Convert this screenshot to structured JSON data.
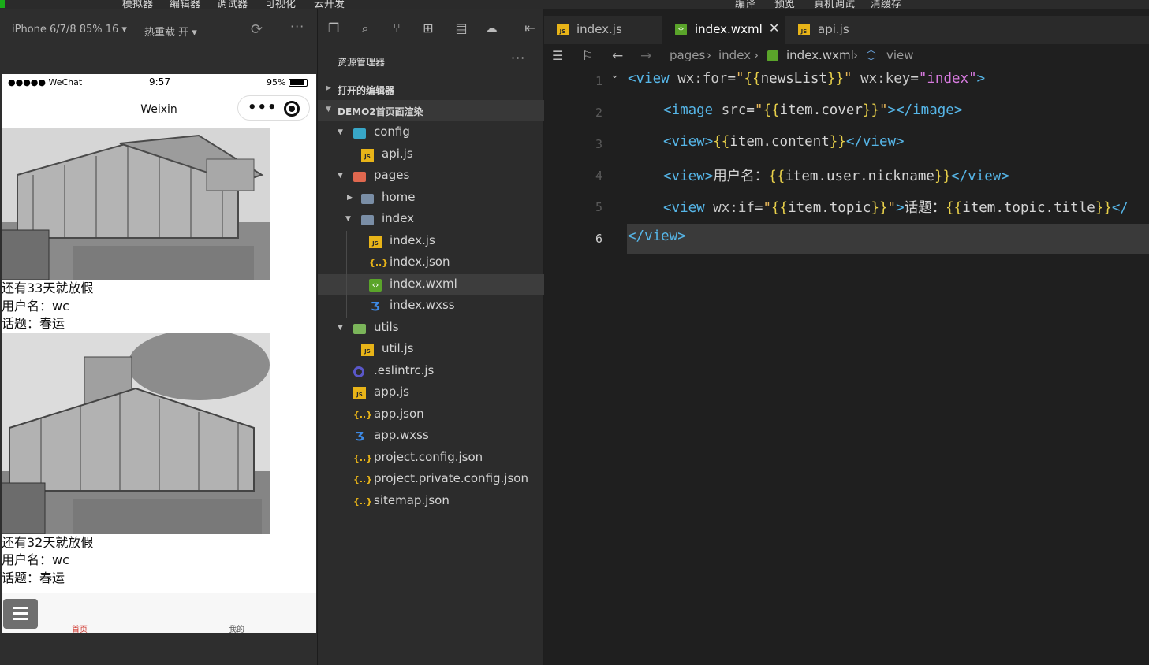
{
  "menubar": {
    "items": [
      "模拟器",
      "编辑器",
      "调试器",
      "可视化",
      "云开发",
      "编译",
      "预览",
      "真机调试",
      "清缓存"
    ]
  },
  "simulator": {
    "device_label": "iPhone 6/7/8 85% 16 ▾",
    "hot_reload_label": "热重载 开 ▾",
    "status": {
      "carrier": "●●●●● WeChat",
      "time": "9:57",
      "battery": "95%"
    },
    "nav_title": "Weixin",
    "news": [
      {
        "line1": "还有33天就放假",
        "line2": "用户名：wc",
        "line3": "话题：春运"
      },
      {
        "line1": "还有32天就放假",
        "line2": "用户名：wc",
        "line3": "话题：春运"
      }
    ],
    "tabs": [
      {
        "label": "首页",
        "color": "#d0342c"
      },
      {
        "label": "我的",
        "color": "#555555"
      }
    ]
  },
  "explorer": {
    "title": "资源管理器",
    "open_editors_label": "打开的编辑器",
    "project_label": "DEMO2首页面渲染",
    "tree": [
      {
        "name": "config",
        "type": "folder-config"
      },
      {
        "name": "api.js",
        "type": "js"
      },
      {
        "name": "pages",
        "type": "folder-pages"
      },
      {
        "name": "home",
        "type": "folder"
      },
      {
        "name": "index",
        "type": "folder"
      },
      {
        "name": "index.js",
        "type": "js"
      },
      {
        "name": "index.json",
        "type": "json"
      },
      {
        "name": "index.wxml",
        "type": "wxml"
      },
      {
        "name": "index.wxss",
        "type": "wxss"
      },
      {
        "name": "utils",
        "type": "folder-utils"
      },
      {
        "name": "util.js",
        "type": "js"
      },
      {
        "name": ".eslintrc.js",
        "type": "eslint"
      },
      {
        "name": "app.js",
        "type": "js"
      },
      {
        "name": "app.json",
        "type": "json"
      },
      {
        "name": "app.wxss",
        "type": "wxss"
      },
      {
        "name": "project.config.json",
        "type": "json"
      },
      {
        "name": "project.private.config.json",
        "type": "json"
      },
      {
        "name": "sitemap.json",
        "type": "json"
      }
    ]
  },
  "editor": {
    "tabs": [
      {
        "label": "index.js",
        "active": false
      },
      {
        "label": "index.wxml",
        "active": true
      },
      {
        "label": "api.js",
        "active": false
      }
    ],
    "breadcrumb": [
      "pages",
      "index",
      "index.wxml",
      "view"
    ],
    "line_numbers": [
      "1",
      "2",
      "3",
      "4",
      "5",
      "6"
    ],
    "code": [
      "<view wx:for=\"{{newsList}}\" wx:key=\"index\">",
      "  <image src=\"{{item.cover}}\"></image>",
      "  <view>{{item.content}}</view>",
      "  <view>用户名：{{item.user.nickname}}</view>",
      "  <view wx:if=\"{{item.topic}}\">话题：{{item.topic.title}}</",
      "</view>"
    ]
  },
  "icons": [
    "explorer-icon",
    "search-icon",
    "source-control-icon",
    "extensions-icon",
    "outline-icon",
    "docker-icon",
    "collapse-icon",
    "list-icon",
    "bookmark-icon",
    "back-icon",
    "forward-icon",
    "refresh-icon"
  ]
}
